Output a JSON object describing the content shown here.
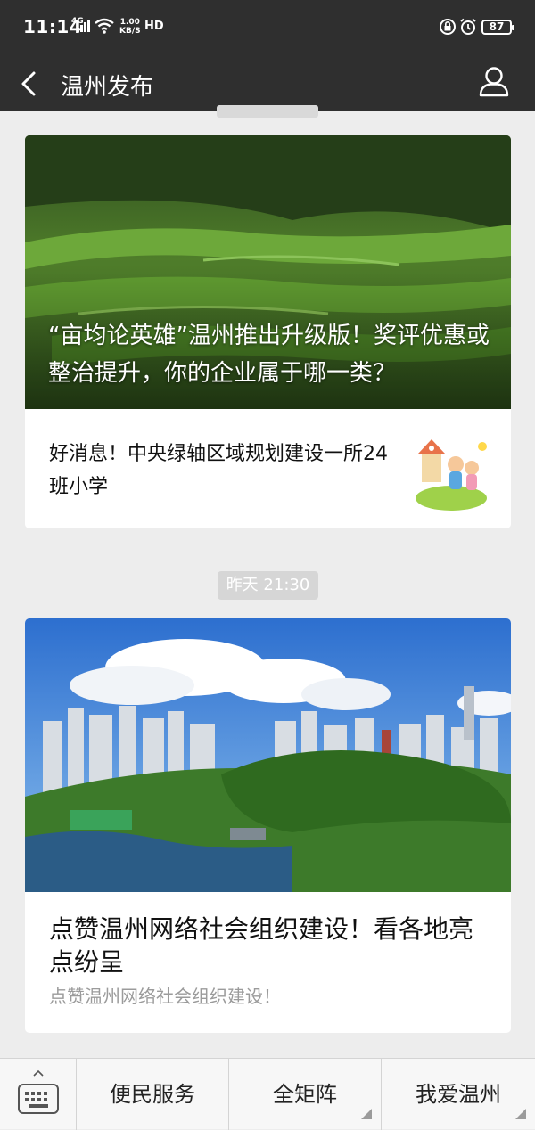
{
  "status_bar": {
    "time": "11:14",
    "signal": "4G",
    "speed_value": "1.00",
    "speed_unit": "KB/S",
    "hd": "HD",
    "battery": "87"
  },
  "header": {
    "title": "温州发布"
  },
  "feed": {
    "timestamp_2": "昨天 21:30",
    "card1": {
      "cover_title": "“亩均论英雄”温州推出升级版！奖评优惠或整治提升，你的企业属于哪一类？",
      "sub_title": "好消息！中央绿轴区域规划建设一所24班小学"
    },
    "card2": {
      "title": "点赞温州网络社会组织建设！看各地亮点纷呈",
      "description": "点赞温州网络社会组织建设！"
    }
  },
  "bottom_menu": {
    "items": [
      {
        "label": "便民服务"
      },
      {
        "label": "全矩阵"
      },
      {
        "label": "我爱温州"
      }
    ]
  },
  "colors": {
    "bar_bg": "#2f2f2f",
    "page_bg": "#ededed"
  }
}
